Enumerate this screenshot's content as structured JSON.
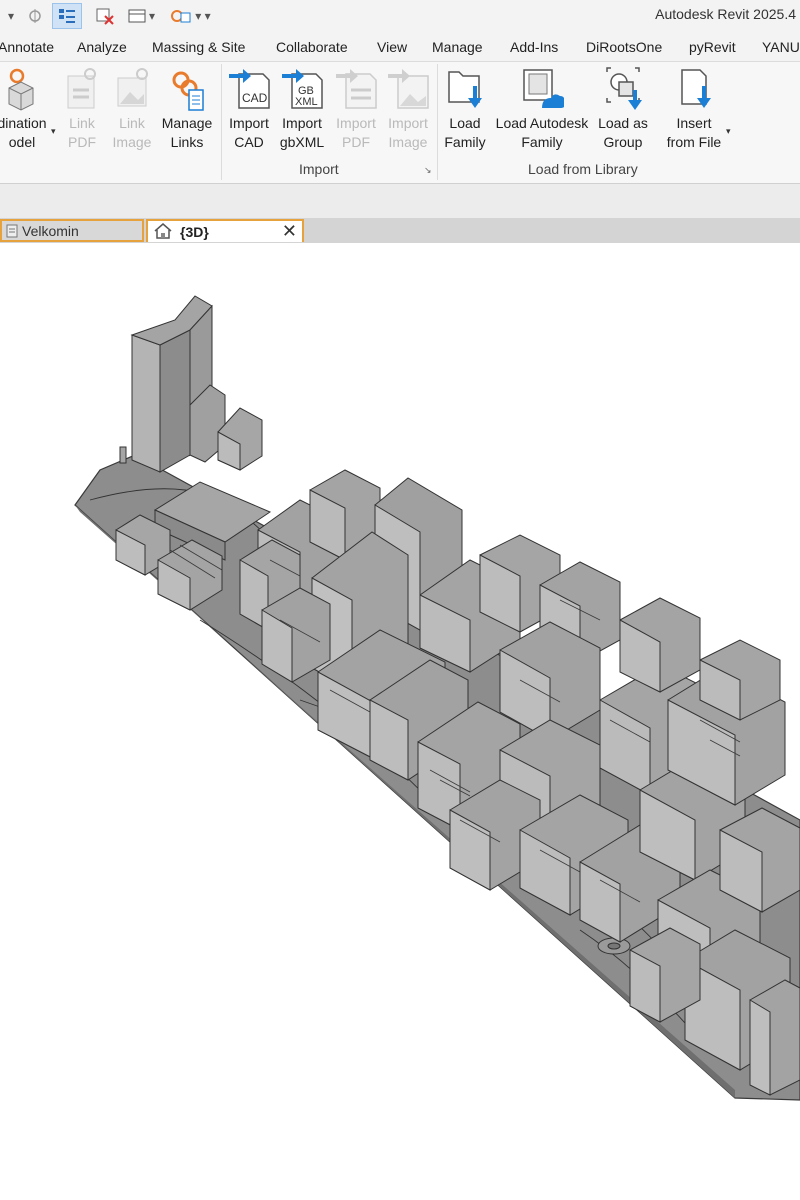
{
  "app": {
    "title": "Autodesk Revit 2025.4"
  },
  "ribbon_tabs": [
    "Annotate",
    "Analyze",
    "Massing & Site",
    "Collaborate",
    "View",
    "Manage",
    "Add-Ins",
    "DiRootsOne",
    "pyRevit",
    "YANU"
  ],
  "link_group": {
    "coordination_model": [
      "dination",
      "odel"
    ],
    "link_pdf": [
      "Link",
      "PDF"
    ],
    "link_image": [
      "Link",
      "Image"
    ],
    "manage_links": [
      "Manage",
      "Links"
    ]
  },
  "import_group": {
    "label": "Import",
    "import_cad": [
      "Import",
      "CAD"
    ],
    "import_gbxml": [
      "Import",
      "gbXML"
    ],
    "import_pdf": [
      "Import",
      "PDF"
    ],
    "import_image": [
      "Import",
      "Image"
    ]
  },
  "load_group": {
    "label": "Load from Library",
    "load_family": [
      "Load",
      "Family"
    ],
    "load_autodesk_family": [
      "Load Autodesk",
      "Family"
    ],
    "load_as_group": [
      "Load as",
      "Group"
    ],
    "insert_from_file": [
      "Insert",
      "from File"
    ]
  },
  "icons": {
    "cad_text": "CAD",
    "gb_text": "GB",
    "xml_text": "XML"
  },
  "doc_tabs": [
    {
      "label": "Velkomin",
      "active": false
    },
    {
      "label": "{3D}",
      "active": true
    }
  ],
  "colors": {
    "accent_orange": "#e6a23c",
    "arrow_blue": "#1c7fd6",
    "building_gray": "#9a9a9a"
  }
}
